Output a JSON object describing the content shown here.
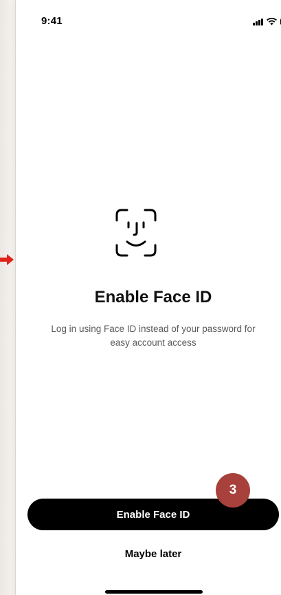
{
  "status_bar": {
    "time": "9:41",
    "icons": [
      "signal-icon",
      "wifi-icon",
      "battery-icon"
    ]
  },
  "face_id": {
    "icon": "face-id-icon",
    "title": "Enable Face ID",
    "description": "Log in using Face ID instead of your password for easy account access"
  },
  "actions": {
    "primary_label": "Enable Face ID",
    "secondary_label": "Maybe later"
  },
  "annotation": {
    "step_number": "3",
    "badge_color": "#a8413b",
    "arrow_color": "#e0231b"
  },
  "colors": {
    "button_background": "#000000",
    "button_text": "#ffffff",
    "body_text": "#5a5a5a"
  }
}
